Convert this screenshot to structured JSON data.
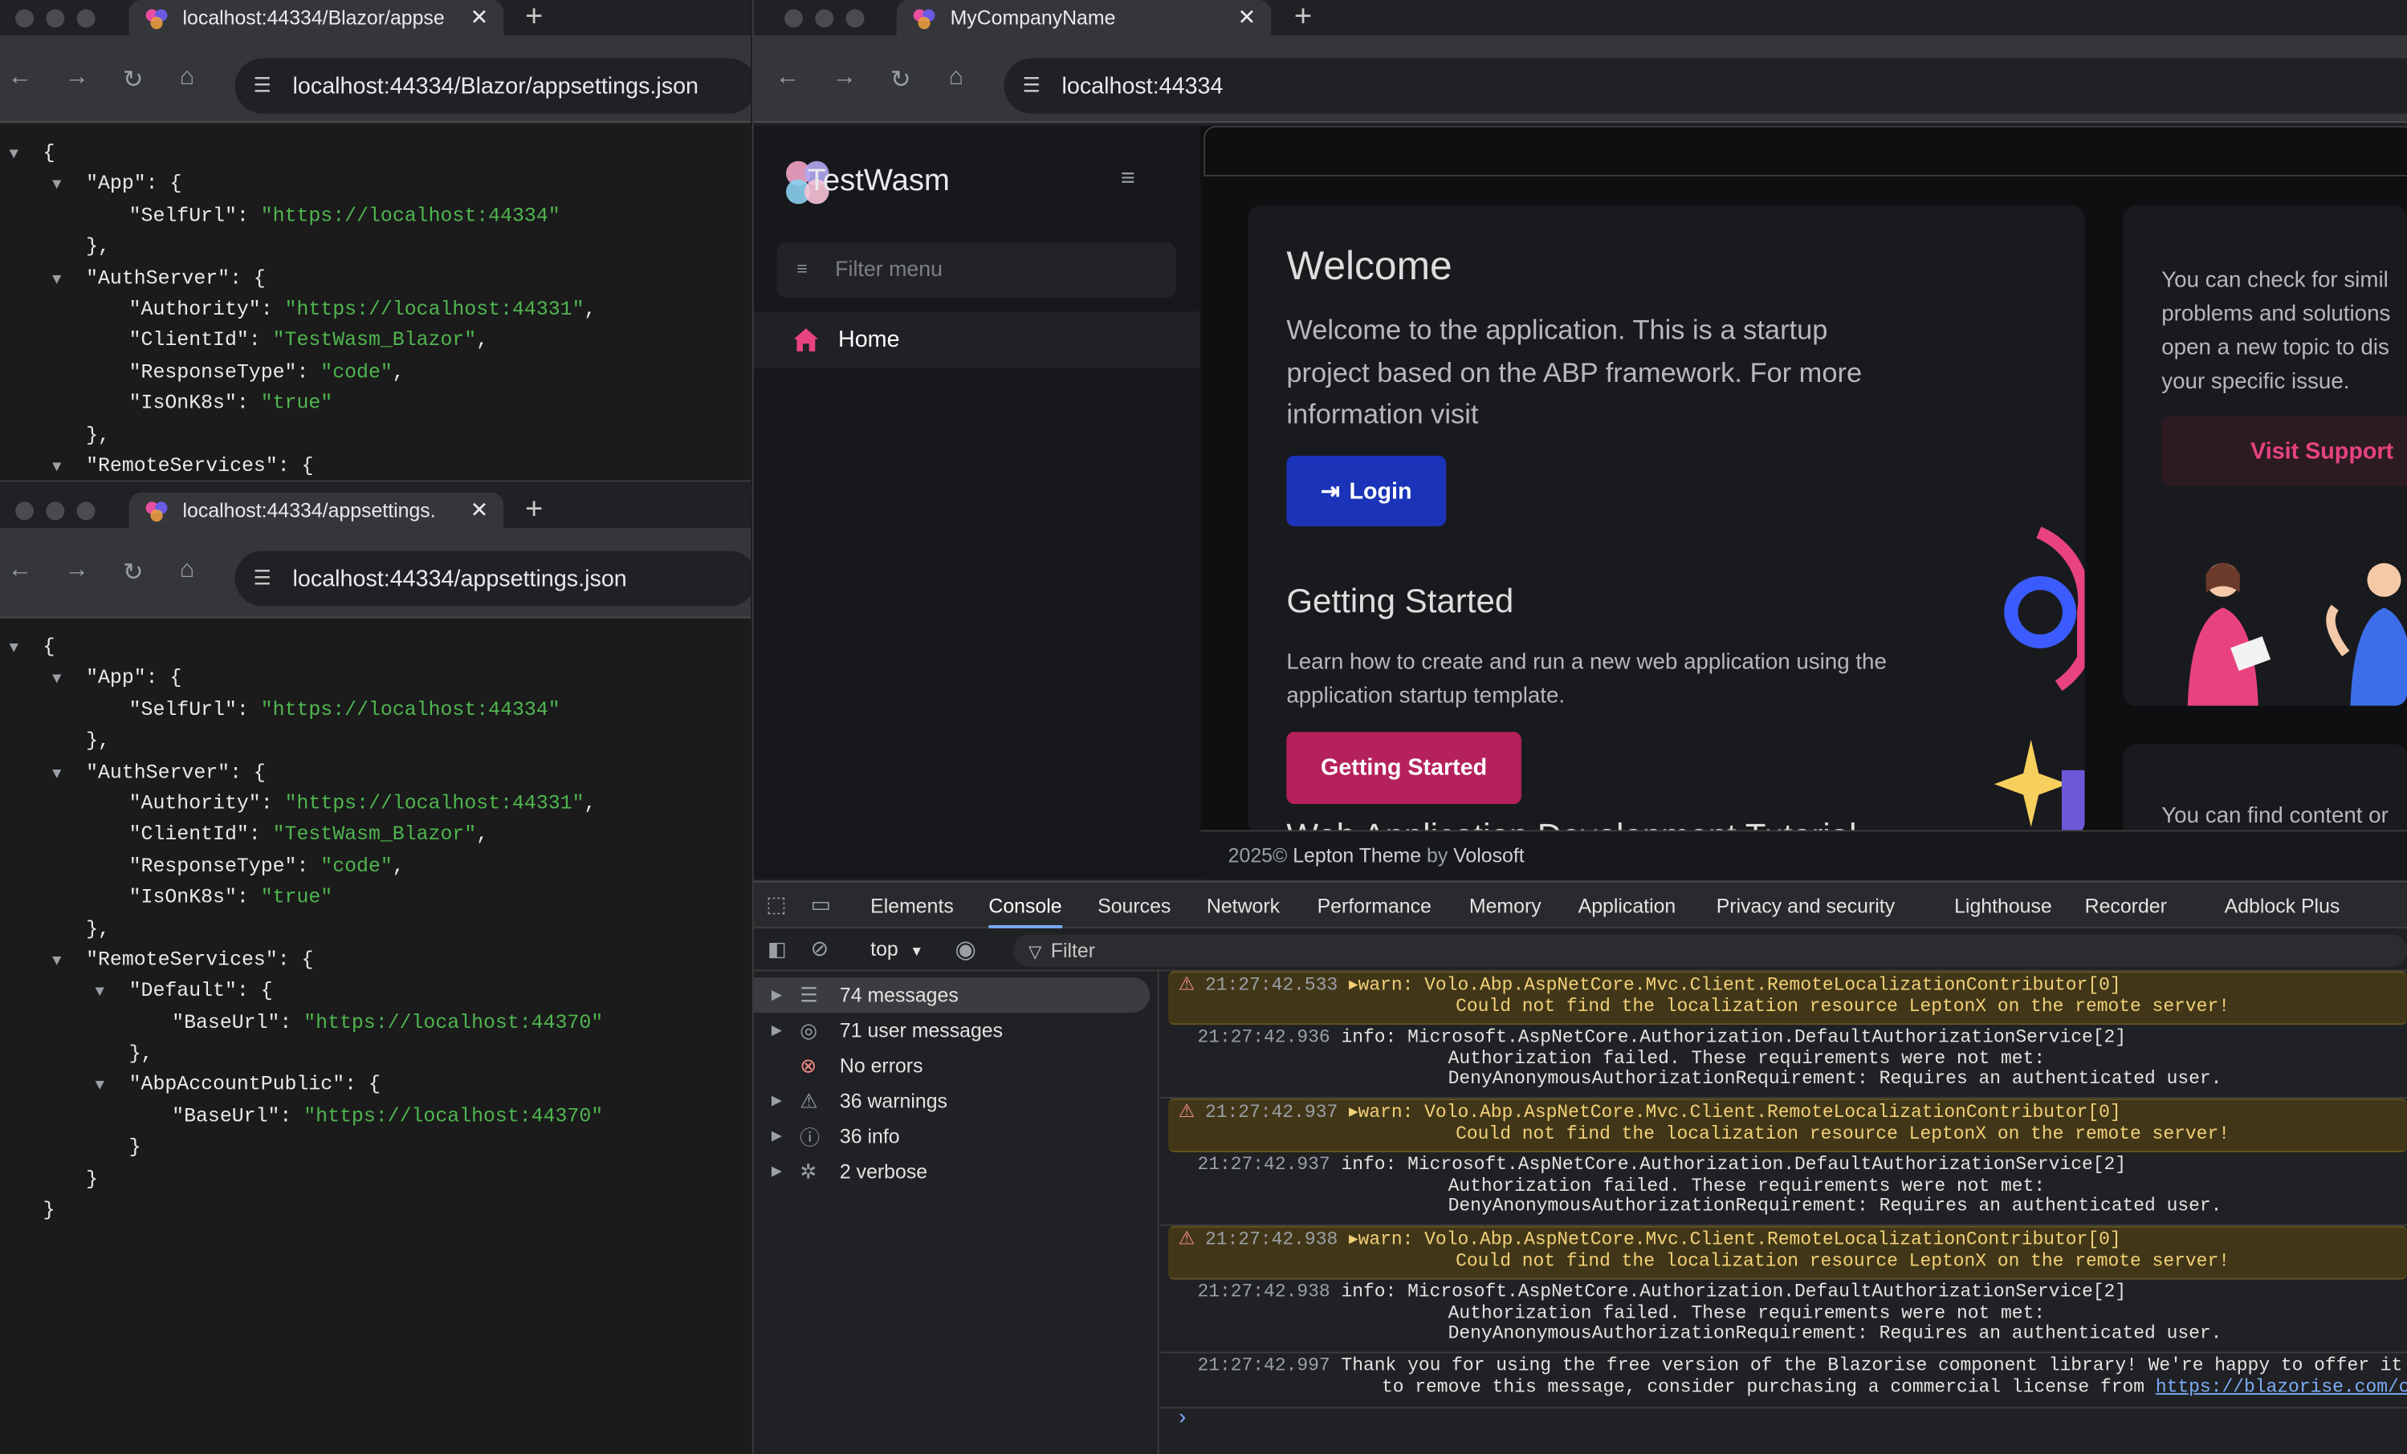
{
  "win1": {
    "tab_title": "localhost:44334/Blazor/appse",
    "url": "localhost:44334/Blazor/appsettings.json",
    "lines": [
      {
        "ind": 0,
        "tri": true,
        "k": "",
        "v": "",
        "p": "{"
      },
      {
        "ind": 1,
        "tri": true,
        "k": "\"App\"",
        "v": "",
        "p": ": {"
      },
      {
        "ind": 2,
        "tri": false,
        "k": "\"SelfUrl\"",
        "v": "\"https://localhost:44334\"",
        "p": ""
      },
      {
        "ind": 1,
        "tri": false,
        "k": "",
        "v": "",
        "p": "},"
      },
      {
        "ind": 1,
        "tri": true,
        "k": "\"AuthServer\"",
        "v": "",
        "p": ": {"
      },
      {
        "ind": 2,
        "tri": false,
        "k": "\"Authority\"",
        "v": "\"https://localhost:44331\"",
        "p": ","
      },
      {
        "ind": 2,
        "tri": false,
        "k": "\"ClientId\"",
        "v": "\"TestWasm_Blazor\"",
        "p": ","
      },
      {
        "ind": 2,
        "tri": false,
        "k": "\"ResponseType\"",
        "v": "\"code\"",
        "p": ","
      },
      {
        "ind": 2,
        "tri": false,
        "k": "\"IsOnK8s\"",
        "v": "\"true\"",
        "p": ""
      },
      {
        "ind": 1,
        "tri": false,
        "k": "",
        "v": "",
        "p": "},"
      },
      {
        "ind": 1,
        "tri": true,
        "k": "\"RemoteServices\"",
        "v": "",
        "p": ": {"
      }
    ]
  },
  "win2": {
    "tab_title": "localhost:44334/appsettings.",
    "url": "localhost:44334/appsettings.json",
    "lines": [
      {
        "ind": 0,
        "tri": true,
        "k": "",
        "v": "",
        "p": "{"
      },
      {
        "ind": 1,
        "tri": true,
        "k": "\"App\"",
        "v": "",
        "p": ": {"
      },
      {
        "ind": 2,
        "tri": false,
        "k": "\"SelfUrl\"",
        "v": "\"https://localhost:44334\"",
        "p": ""
      },
      {
        "ind": 1,
        "tri": false,
        "k": "",
        "v": "",
        "p": "},"
      },
      {
        "ind": 1,
        "tri": true,
        "k": "\"AuthServer\"",
        "v": "",
        "p": ": {"
      },
      {
        "ind": 2,
        "tri": false,
        "k": "\"Authority\"",
        "v": "\"https://localhost:44331\"",
        "p": ","
      },
      {
        "ind": 2,
        "tri": false,
        "k": "\"ClientId\"",
        "v": "\"TestWasm_Blazor\"",
        "p": ","
      },
      {
        "ind": 2,
        "tri": false,
        "k": "\"ResponseType\"",
        "v": "\"code\"",
        "p": ","
      },
      {
        "ind": 2,
        "tri": false,
        "k": "\"IsOnK8s\"",
        "v": "\"true\"",
        "p": ""
      },
      {
        "ind": 1,
        "tri": false,
        "k": "",
        "v": "",
        "p": "},"
      },
      {
        "ind": 1,
        "tri": true,
        "k": "\"RemoteServices\"",
        "v": "",
        "p": ": {"
      },
      {
        "ind": 2,
        "tri": true,
        "k": "\"Default\"",
        "v": "",
        "p": ": {"
      },
      {
        "ind": 3,
        "tri": false,
        "k": "\"BaseUrl\"",
        "v": "\"https://localhost:44370\"",
        "p": ""
      },
      {
        "ind": 2,
        "tri": false,
        "k": "",
        "v": "",
        "p": "},"
      },
      {
        "ind": 2,
        "tri": true,
        "k": "\"AbpAccountPublic\"",
        "v": "",
        "p": ": {"
      },
      {
        "ind": 3,
        "tri": false,
        "k": "\"BaseUrl\"",
        "v": "\"https://localhost:44370\"",
        "p": ""
      },
      {
        "ind": 2,
        "tri": false,
        "k": "",
        "v": "",
        "p": "}"
      },
      {
        "ind": 1,
        "tri": false,
        "k": "",
        "v": "",
        "p": "}"
      },
      {
        "ind": 0,
        "tri": false,
        "k": "",
        "v": "",
        "p": "}"
      }
    ]
  },
  "win3": {
    "tab_title": "MyCompanyName",
    "url": "localhost:44334"
  },
  "app": {
    "brand": "TestWasm",
    "filter_placeholder": "Filter menu",
    "menu_home": "Home",
    "welcome_title": "Welcome",
    "welcome_text": "Welcome to the application. This is a startup project based on the ABP framework. For more information visit",
    "login_label": "Login",
    "gs_title": "Getting Started",
    "gs_text": "Learn how to create and run a new web application using the application startup template.",
    "gs_button": "Getting Started",
    "cut_heading": "Web Application Development Tutorial",
    "support_text": "You can check for simil problems and solutions open a new topic to dis your specific issue.",
    "support_button": "Visit Support",
    "content_text": "You can find content or",
    "footer_year": "2025©",
    "footer_theme": "Lepton Theme",
    "footer_by": "by",
    "footer_vendor": "Volosoft",
    "accent": "#b5215c",
    "login_color": "#1a33b8"
  },
  "devtools": {
    "tabs": [
      "Elements",
      "Console",
      "Sources",
      "Network",
      "Performance",
      "Memory",
      "Application",
      "Privacy and security",
      "Lighthouse",
      "Recorder",
      "Adblock Plus"
    ],
    "active_tab": "Console",
    "context": "top",
    "filter": "Filter",
    "sidebar": [
      {
        "label": "74 messages",
        "icon": "list-icon"
      },
      {
        "label": "71 user messages",
        "icon": "user-icon"
      },
      {
        "label": "No errors",
        "icon": "error-icon"
      },
      {
        "label": "36 warnings",
        "icon": "warning-icon"
      },
      {
        "label": "36 info",
        "icon": "info-icon"
      },
      {
        "label": "2 verbose",
        "icon": "bug-icon"
      }
    ],
    "logs": [
      {
        "type": "warn",
        "ts": "21:27:42.533",
        "l1": "warn: Volo.Abp.AspNetCore.Mvc.Client.RemoteLocalizationContributor[0]",
        "l2": "      Could not find the localization resource LeptonX on the remote server!",
        "l3": ""
      },
      {
        "type": "info",
        "ts": "21:27:42.936",
        "l1": "info: Microsoft.AspNetCore.Authorization.DefaultAuthorizationService[2]",
        "l2": "      Authorization failed. These requirements were not met:",
        "l3": "      DenyAnonymousAuthorizationRequirement: Requires an authenticated user."
      },
      {
        "type": "warn",
        "ts": "21:27:42.937",
        "l1": "warn: Volo.Abp.AspNetCore.Mvc.Client.RemoteLocalizationContributor[0]",
        "l2": "      Could not find the localization resource LeptonX on the remote server!",
        "l3": ""
      },
      {
        "type": "info",
        "ts": "21:27:42.937",
        "l1": "info: Microsoft.AspNetCore.Authorization.DefaultAuthorizationService[2]",
        "l2": "      Authorization failed. These requirements were not met:",
        "l3": "      DenyAnonymousAuthorizationRequirement: Requires an authenticated user."
      },
      {
        "type": "warn",
        "ts": "21:27:42.938",
        "l1": "warn: Volo.Abp.AspNetCore.Mvc.Client.RemoteLocalizationContributor[0]",
        "l2": "      Could not find the localization resource LeptonX on the remote server!",
        "l3": ""
      },
      {
        "type": "info",
        "ts": "21:27:42.938",
        "l1": "info: Microsoft.AspNetCore.Authorization.DefaultAuthorizationService[2]",
        "l2": "      Authorization failed. These requirements were not met:",
        "l3": "      DenyAnonymousAuthorizationRequirement: Requires an authenticated user."
      },
      {
        "type": "log",
        "ts": "21:27:42.997",
        "l1": "Thank you for using the free version of the Blazorise component library! We're happy to offer it to y",
        "l2": "to remove this message, consider purchasing a commercial license from ",
        "link": "https://blazorise.com/commercia",
        "l3": ""
      }
    ],
    "prompt": "›"
  }
}
